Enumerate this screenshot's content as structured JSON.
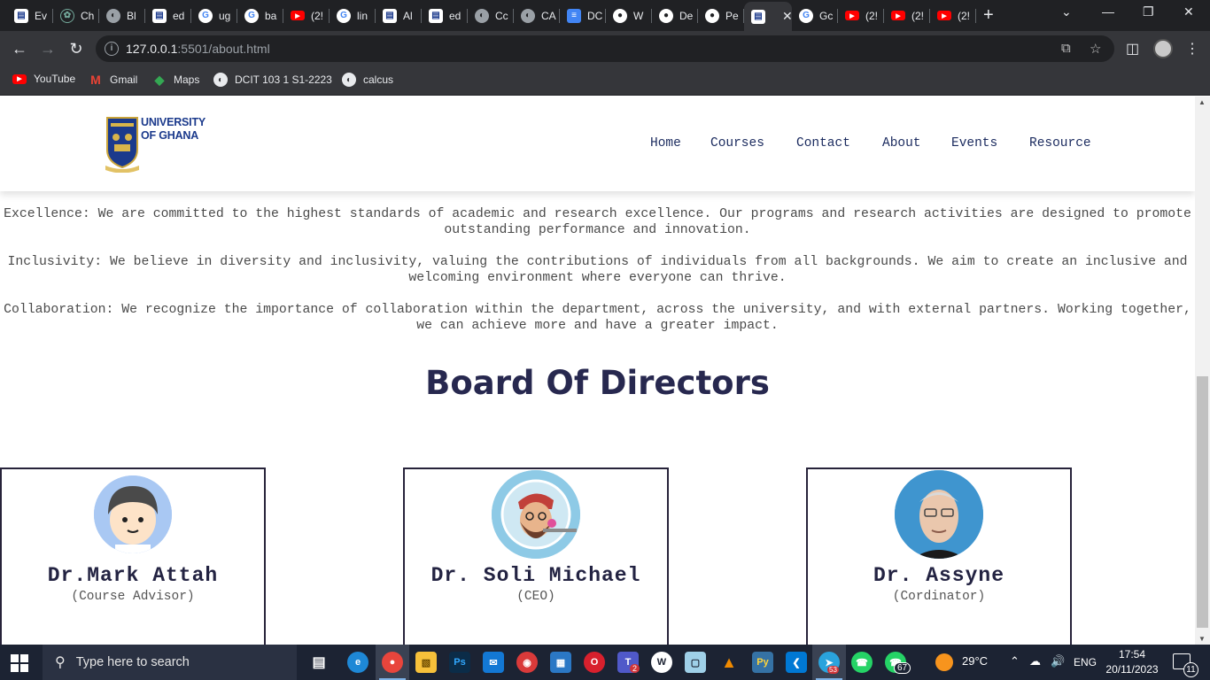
{
  "browser": {
    "tabs": [
      {
        "label": "Ev",
        "icon": "doc-icon",
        "color": "#ffffff"
      },
      {
        "label": "Ch",
        "icon": "chatgpt-icon",
        "color": "#74aa9c"
      },
      {
        "label": "Bl",
        "icon": "globe-icon",
        "color": "#9aa0a6"
      },
      {
        "label": "ed",
        "icon": "doc-icon",
        "color": "#ffffff"
      },
      {
        "label": "ug",
        "icon": "google-icon",
        "color": "#4285f4"
      },
      {
        "label": "ba",
        "icon": "google-icon",
        "color": "#4285f4"
      },
      {
        "label": "(2!",
        "icon": "youtube-icon",
        "color": "#ff0000"
      },
      {
        "label": "lin",
        "icon": "google-icon",
        "color": "#4285f4"
      },
      {
        "label": "Al",
        "icon": "doc-icon",
        "color": "#ffffff"
      },
      {
        "label": "ed",
        "icon": "doc-icon",
        "color": "#ffffff"
      },
      {
        "label": "Cc",
        "icon": "globe-icon",
        "color": "#9aa0a6"
      },
      {
        "label": "CA",
        "icon": "globe-icon",
        "color": "#9aa0a6"
      },
      {
        "label": "DC",
        "icon": "docs-icon",
        "color": "#4285f4"
      },
      {
        "label": "W",
        "icon": "github-icon",
        "color": "#ffffff"
      },
      {
        "label": "De",
        "icon": "github-icon",
        "color": "#ffffff"
      },
      {
        "label": "Pe",
        "icon": "github-icon",
        "color": "#ffffff"
      },
      {
        "label": "",
        "icon": "doc-icon",
        "color": "#ffffff",
        "active": true
      },
      {
        "label": "Gc",
        "icon": "google-icon",
        "color": "#4285f4"
      },
      {
        "label": "(2!",
        "icon": "youtube-icon",
        "color": "#ff0000"
      },
      {
        "label": "(2!",
        "icon": "youtube-icon",
        "color": "#ff0000"
      },
      {
        "label": "(2!",
        "icon": "youtube-icon",
        "color": "#ff0000"
      }
    ],
    "url_host": "127.0.0.1",
    "url_rest": ":5501/about.html",
    "bookmarks": [
      {
        "label": "YouTube",
        "icon": "youtube-icon"
      },
      {
        "label": "Gmail",
        "icon": "gmail-icon"
      },
      {
        "label": "Maps",
        "icon": "maps-icon"
      },
      {
        "label": "DCIT 103 1 S1-2223",
        "icon": "globe-icon"
      },
      {
        "label": "calcus",
        "icon": "globe-icon"
      }
    ]
  },
  "site": {
    "logo_line1": "UNIVERSITY",
    "logo_line2": "OF GHANA",
    "nav": [
      "Home",
      "Courses",
      "Contact",
      "About",
      "Events",
      "Resource"
    ],
    "values": [
      "Excellence: We are committed to the highest standards of academic and research excellence. Our programs and research activities are designed to promote outstanding performance and innovation.",
      "Inclusivity: We believe in diversity and inclusivity, valuing the contributions of individuals from all backgrounds. We aim to create an inclusive and welcoming environment where everyone can thrive.",
      "Collaboration: We recognize the importance of collaboration within the department, across the university, and with external partners. Working together, we can achieve more and have a greater impact."
    ],
    "board_title": "Board Of Directors",
    "directors": [
      {
        "name": "Dr.Mark Attah",
        "role": "(Course Advisor)"
      },
      {
        "name": "Dr. Soli Michael",
        "role": "(CEO)"
      },
      {
        "name": "Dr. Assyne",
        "role": "(Cordinator)"
      }
    ]
  },
  "taskbar": {
    "search_placeholder": "Type here to search",
    "temperature": "29°C",
    "language": "ENG",
    "time": "17:54",
    "date": "20/11/2023",
    "notification_count": "11",
    "badges": {
      "teams": "2",
      "telegram": "53",
      "whatsapp": "67"
    }
  }
}
